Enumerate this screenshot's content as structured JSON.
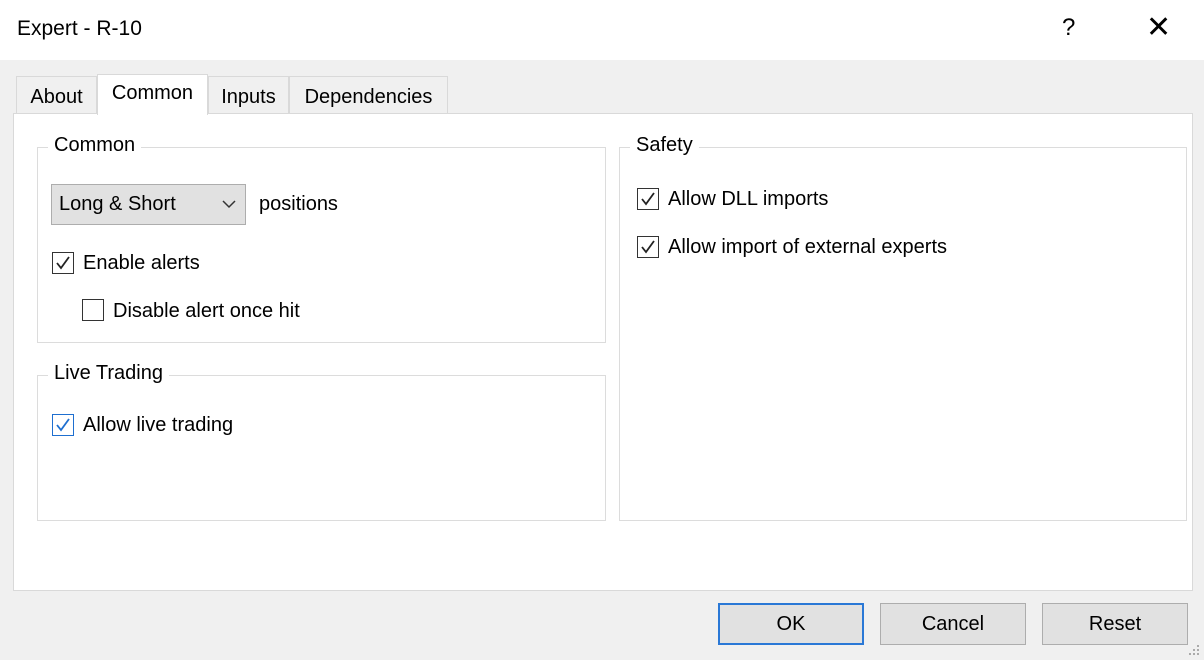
{
  "window": {
    "title": "Expert - R-10",
    "help_icon": "?",
    "close_icon": "✕"
  },
  "tabs": [
    {
      "label": "About"
    },
    {
      "label": "Common",
      "active": true
    },
    {
      "label": "Inputs"
    },
    {
      "label": "Dependencies"
    }
  ],
  "common": {
    "title": "Common",
    "position_mode": "Long & Short",
    "positions_label": "positions",
    "enable_alerts": {
      "label": "Enable alerts",
      "checked": true
    },
    "disable_alert": {
      "label": "Disable alert once hit",
      "checked": false
    }
  },
  "live": {
    "title": "Live Trading",
    "allow_live": {
      "label": "Allow live trading",
      "checked": true
    }
  },
  "safety": {
    "title": "Safety",
    "allow_dll": {
      "label": "Allow DLL imports",
      "checked": true
    },
    "allow_external": {
      "label": "Allow import of external experts",
      "checked": true
    }
  },
  "buttons": {
    "ok": "OK",
    "cancel": "Cancel",
    "reset": "Reset"
  }
}
